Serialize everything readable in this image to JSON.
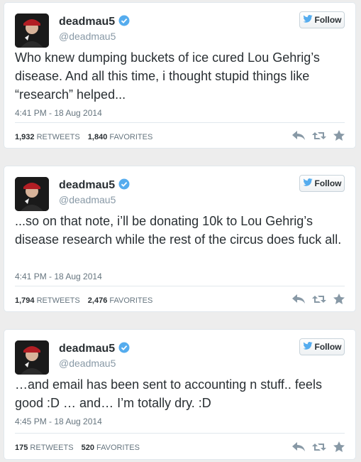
{
  "tweets": [
    {
      "name": "deadmau5",
      "handle": "@deadmau5",
      "follow_label": "Follow",
      "text": "Who knew dumping buckets of ice cured Lou Gehrig’s disease. And all this time, i thought stupid things like “research” helped...",
      "time": "4:41 PM - 18 Aug 2014",
      "retweets": "1,932",
      "retweets_label": "RETWEETS",
      "favorites": "1,840",
      "favorites_label": "FAVORITES"
    },
    {
      "name": "deadmau5",
      "handle": "@deadmau5",
      "follow_label": "Follow",
      "text": "...so on that note, i’ll be donating 10k to Lou Gehrig’s disease research while the rest of the circus does fuck all.",
      "time": "4:41 PM - 18 Aug 2014",
      "retweets": "1,794",
      "retweets_label": "RETWEETS",
      "favorites": "2,476",
      "favorites_label": "FAVORITES"
    },
    {
      "name": "deadmau5",
      "handle": "@deadmau5",
      "follow_label": "Follow",
      "text": "…and email has been sent to accounting n stuff.. feels good :D  … and… I’m totally dry. :D",
      "time": "4:45 PM - 18 Aug 2014",
      "retweets": "175",
      "retweets_label": "RETWEETS",
      "favorites": "520",
      "favorites_label": "FAVORITES"
    }
  ],
  "colors": {
    "verified": "#55acee",
    "bird": "#55acee",
    "icon": "#8899a6"
  },
  "icons": [
    "avatar",
    "verified-badge-icon",
    "twitter-bird-icon",
    "reply-icon",
    "retweet-icon",
    "favorite-icon"
  ]
}
